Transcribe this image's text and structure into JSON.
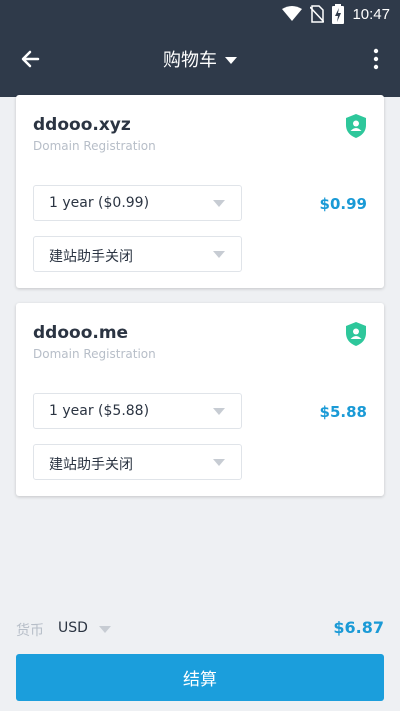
{
  "status": {
    "time": "10:47"
  },
  "header": {
    "title": "购物车"
  },
  "cart": [
    {
      "domain": "ddooo.xyz",
      "subtitle": "Domain Registration",
      "term": "1 year ($0.99)",
      "addon": "建站助手关闭",
      "price": "$0.99"
    },
    {
      "domain": "ddooo.me",
      "subtitle": "Domain Registration",
      "term": "1 year ($5.88)",
      "addon": "建站助手关闭",
      "price": "$5.88"
    }
  ],
  "footer": {
    "currency_label": "货币",
    "currency_value": "USD",
    "total": "$6.87",
    "checkout_label": "结算"
  },
  "colors": {
    "appbar": "#2f3a4a",
    "accent": "#1b9edc",
    "price": "#1a9ad6",
    "shield": "#2ec79b"
  }
}
